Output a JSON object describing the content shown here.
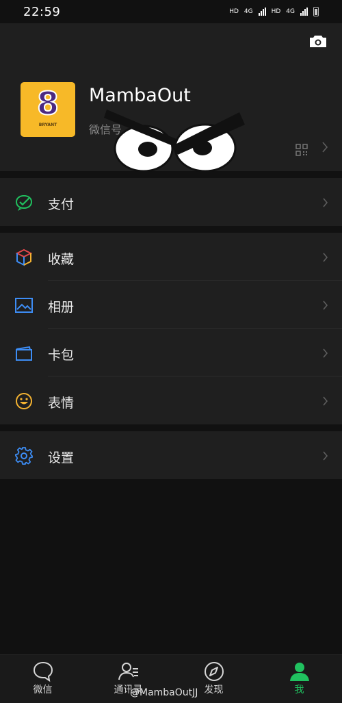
{
  "status_bar": {
    "time": "22:59",
    "network_1": "HD",
    "network_2": "HD",
    "gen_1": "4G",
    "gen_2": "4G"
  },
  "profile": {
    "nickname": "MambaOut",
    "wechat_id_label": "微信号",
    "avatar_number": "8",
    "avatar_caption": "BRYANT"
  },
  "menu": {
    "pay": "支付",
    "favorites": "收藏",
    "album": "相册",
    "cards": "卡包",
    "stickers": "表情",
    "settings": "设置"
  },
  "tabbar": {
    "chats": "微信",
    "contacts": "通讯录",
    "discover": "发现",
    "me": "我"
  },
  "watermark": "@MambaOutJJ",
  "colors": {
    "accent_green": "#20c15f",
    "background": "#111111",
    "surface": "#1f1f1f",
    "avatar_bg": "#f7b928"
  }
}
